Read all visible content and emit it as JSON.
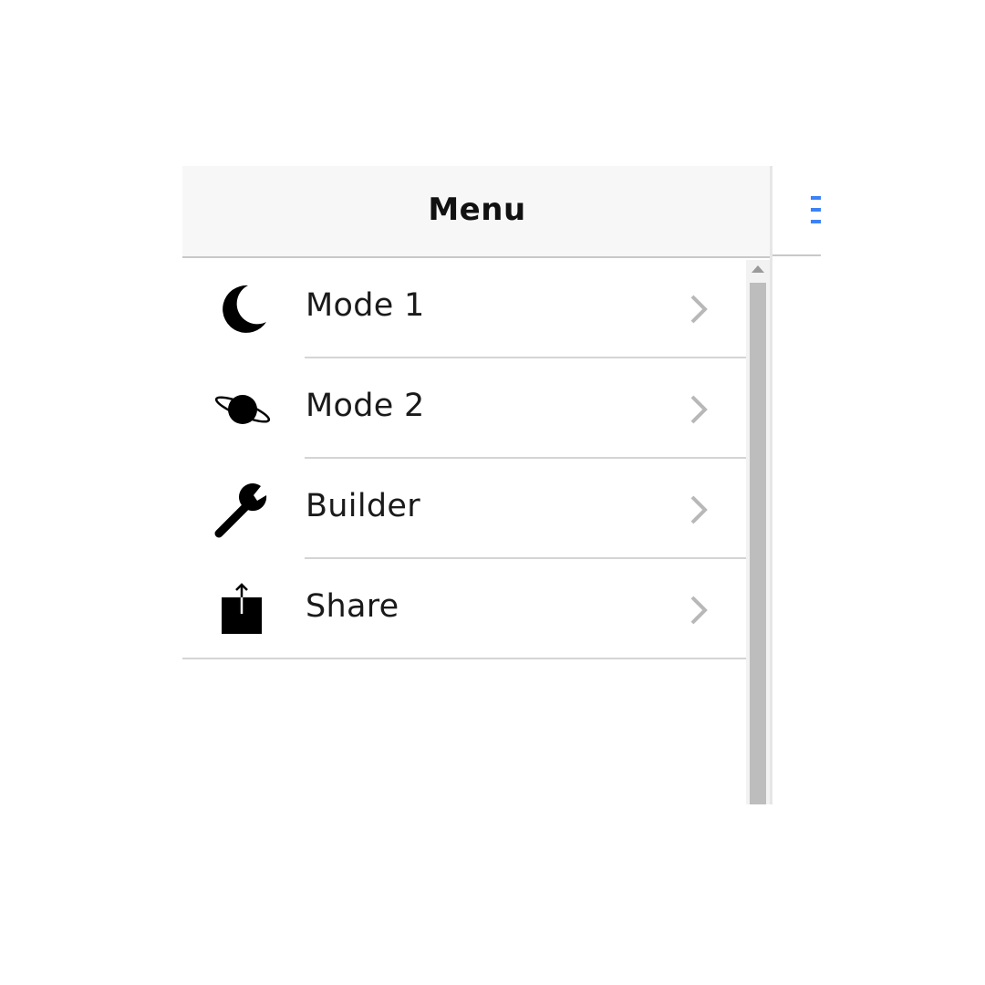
{
  "header": {
    "title": "Menu"
  },
  "menu": {
    "items": [
      {
        "label": "Mode 1",
        "icon": "moon-icon"
      },
      {
        "label": "Mode 2",
        "icon": "planet-icon"
      },
      {
        "label": "Builder",
        "icon": "wrench-icon"
      },
      {
        "label": "Share",
        "icon": "share-icon"
      }
    ]
  },
  "colors": {
    "header_bg": "#f7f7f7",
    "accent": "#3b82f6",
    "chevron": "#b8b8b8",
    "separator": "#d4d4d4"
  }
}
